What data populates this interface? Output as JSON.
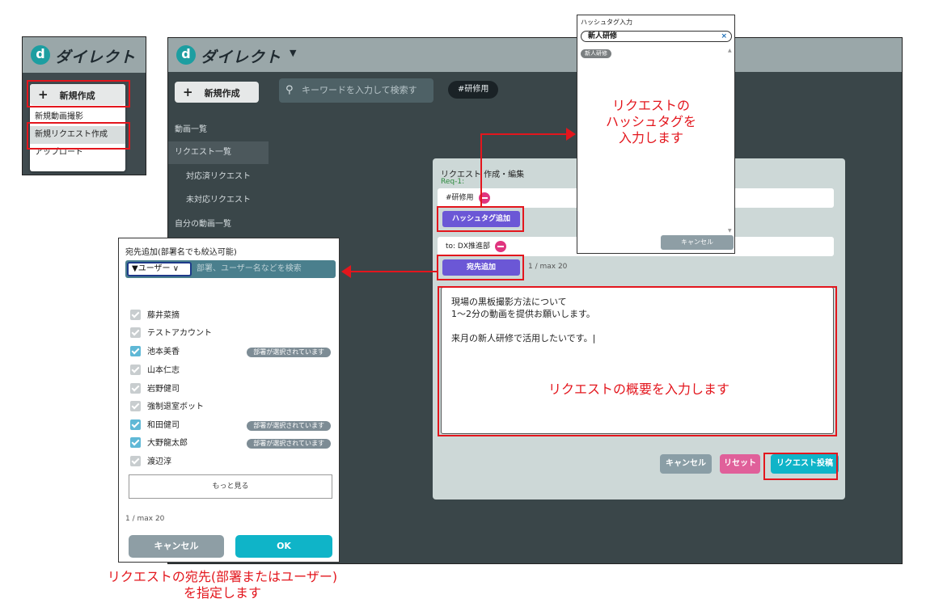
{
  "brand": {
    "logo_letter": "d",
    "logo_text": "ダイレクト"
  },
  "mini": {
    "new_button": "新規作成",
    "menu": [
      "新規動画撮影",
      "新規リクエスト作成",
      "アップロード"
    ]
  },
  "main": {
    "new_button": "新規作成",
    "sidebar": [
      "動画一覧",
      "リクエスト一覧",
      "対応済リクエスト",
      "未対応リクエスト",
      "自分の動画一覧"
    ],
    "search_placeholder": "キーワードを入力して検索す",
    "tag_chip": "#研修用"
  },
  "form": {
    "title": "リクエスト 作成・編集",
    "req_id": "Req-1:",
    "hashtag_value": "#研修用",
    "hashtag_add": "ハッシュタグ追加",
    "to_value": "to: DX推進部",
    "dest_add": "宛先追加",
    "dest_count": "1 / max 20",
    "desc_lines": [
      "現場の黒板撮影方法について",
      "1～2分の動画を提供お願いします。",
      "",
      "来月の新人研修で活用したいです。|"
    ],
    "cancel": "キャンセル",
    "reset": "リセット",
    "submit": "リクエスト投稿"
  },
  "hashtag_popup": {
    "title": "ハッシュタグ入力",
    "input_value": "新人研修",
    "clear": "×",
    "suggestion": "新人研修",
    "cancel": "キャンセル"
  },
  "dest_popup": {
    "title": "宛先追加(部署名でも絞込可能)",
    "filter_label": "ユーザー",
    "placeholder": "部署、ユーザー名などを検索",
    "users": [
      {
        "name": "藤井菜摘",
        "checked": false,
        "badge": ""
      },
      {
        "name": "テストアカウント",
        "checked": false,
        "badge": ""
      },
      {
        "name": "池本美香",
        "checked": true,
        "badge": "部署が選択されています"
      },
      {
        "name": "山本仁志",
        "checked": false,
        "badge": ""
      },
      {
        "name": "岩野健司",
        "checked": false,
        "badge": ""
      },
      {
        "name": "強制退室ボット",
        "checked": false,
        "badge": ""
      },
      {
        "name": "和田健司",
        "checked": true,
        "badge": "部署が選択されています"
      },
      {
        "name": "大野龍太郎",
        "checked": true,
        "badge": "部署が選択されています"
      },
      {
        "name": "渡辺淳",
        "checked": false,
        "badge": ""
      }
    ],
    "more": "もっと見る",
    "count": "1 / max 20",
    "cancel": "キャンセル",
    "ok": "OK"
  },
  "annotations": {
    "hashtag": [
      "リクエストの",
      "ハッシュタグを",
      "入力します"
    ],
    "desc": "リクエストの概要を入力します",
    "dest": [
      "リクエストの宛先(部署またはユーザー)",
      "を指定します"
    ]
  },
  "colors": {
    "accent_red": "#e3161d",
    "teal": "#0fb4c8",
    "purple": "#6b57d6",
    "pink": "#e0609a"
  }
}
